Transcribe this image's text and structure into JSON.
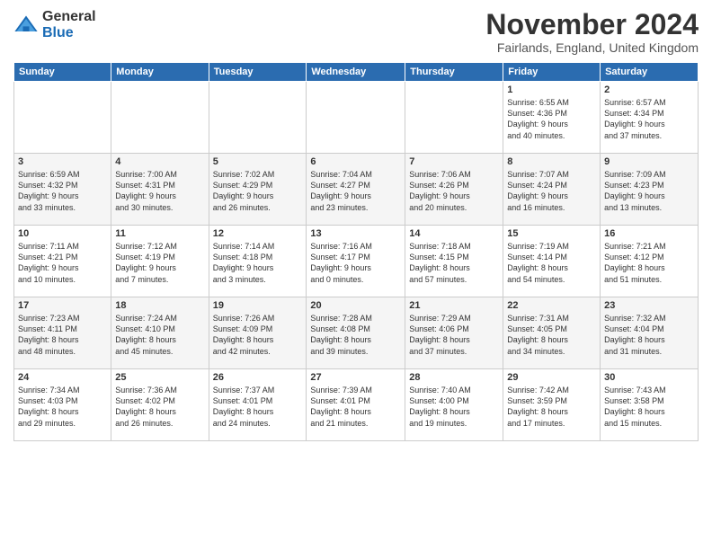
{
  "logo": {
    "general": "General",
    "blue": "Blue"
  },
  "title": "November 2024",
  "subtitle": "Fairlands, England, United Kingdom",
  "days_header": [
    "Sunday",
    "Monday",
    "Tuesday",
    "Wednesday",
    "Thursday",
    "Friday",
    "Saturday"
  ],
  "weeks": [
    [
      {
        "day": "",
        "info": ""
      },
      {
        "day": "",
        "info": ""
      },
      {
        "day": "",
        "info": ""
      },
      {
        "day": "",
        "info": ""
      },
      {
        "day": "",
        "info": ""
      },
      {
        "day": "1",
        "info": "Sunrise: 6:55 AM\nSunset: 4:36 PM\nDaylight: 9 hours\nand 40 minutes."
      },
      {
        "day": "2",
        "info": "Sunrise: 6:57 AM\nSunset: 4:34 PM\nDaylight: 9 hours\nand 37 minutes."
      }
    ],
    [
      {
        "day": "3",
        "info": "Sunrise: 6:59 AM\nSunset: 4:32 PM\nDaylight: 9 hours\nand 33 minutes."
      },
      {
        "day": "4",
        "info": "Sunrise: 7:00 AM\nSunset: 4:31 PM\nDaylight: 9 hours\nand 30 minutes."
      },
      {
        "day": "5",
        "info": "Sunrise: 7:02 AM\nSunset: 4:29 PM\nDaylight: 9 hours\nand 26 minutes."
      },
      {
        "day": "6",
        "info": "Sunrise: 7:04 AM\nSunset: 4:27 PM\nDaylight: 9 hours\nand 23 minutes."
      },
      {
        "day": "7",
        "info": "Sunrise: 7:06 AM\nSunset: 4:26 PM\nDaylight: 9 hours\nand 20 minutes."
      },
      {
        "day": "8",
        "info": "Sunrise: 7:07 AM\nSunset: 4:24 PM\nDaylight: 9 hours\nand 16 minutes."
      },
      {
        "day": "9",
        "info": "Sunrise: 7:09 AM\nSunset: 4:23 PM\nDaylight: 9 hours\nand 13 minutes."
      }
    ],
    [
      {
        "day": "10",
        "info": "Sunrise: 7:11 AM\nSunset: 4:21 PM\nDaylight: 9 hours\nand 10 minutes."
      },
      {
        "day": "11",
        "info": "Sunrise: 7:12 AM\nSunset: 4:19 PM\nDaylight: 9 hours\nand 7 minutes."
      },
      {
        "day": "12",
        "info": "Sunrise: 7:14 AM\nSunset: 4:18 PM\nDaylight: 9 hours\nand 3 minutes."
      },
      {
        "day": "13",
        "info": "Sunrise: 7:16 AM\nSunset: 4:17 PM\nDaylight: 9 hours\nand 0 minutes."
      },
      {
        "day": "14",
        "info": "Sunrise: 7:18 AM\nSunset: 4:15 PM\nDaylight: 8 hours\nand 57 minutes."
      },
      {
        "day": "15",
        "info": "Sunrise: 7:19 AM\nSunset: 4:14 PM\nDaylight: 8 hours\nand 54 minutes."
      },
      {
        "day": "16",
        "info": "Sunrise: 7:21 AM\nSunset: 4:12 PM\nDaylight: 8 hours\nand 51 minutes."
      }
    ],
    [
      {
        "day": "17",
        "info": "Sunrise: 7:23 AM\nSunset: 4:11 PM\nDaylight: 8 hours\nand 48 minutes."
      },
      {
        "day": "18",
        "info": "Sunrise: 7:24 AM\nSunset: 4:10 PM\nDaylight: 8 hours\nand 45 minutes."
      },
      {
        "day": "19",
        "info": "Sunrise: 7:26 AM\nSunset: 4:09 PM\nDaylight: 8 hours\nand 42 minutes."
      },
      {
        "day": "20",
        "info": "Sunrise: 7:28 AM\nSunset: 4:08 PM\nDaylight: 8 hours\nand 39 minutes."
      },
      {
        "day": "21",
        "info": "Sunrise: 7:29 AM\nSunset: 4:06 PM\nDaylight: 8 hours\nand 37 minutes."
      },
      {
        "day": "22",
        "info": "Sunrise: 7:31 AM\nSunset: 4:05 PM\nDaylight: 8 hours\nand 34 minutes."
      },
      {
        "day": "23",
        "info": "Sunrise: 7:32 AM\nSunset: 4:04 PM\nDaylight: 8 hours\nand 31 minutes."
      }
    ],
    [
      {
        "day": "24",
        "info": "Sunrise: 7:34 AM\nSunset: 4:03 PM\nDaylight: 8 hours\nand 29 minutes."
      },
      {
        "day": "25",
        "info": "Sunrise: 7:36 AM\nSunset: 4:02 PM\nDaylight: 8 hours\nand 26 minutes."
      },
      {
        "day": "26",
        "info": "Sunrise: 7:37 AM\nSunset: 4:01 PM\nDaylight: 8 hours\nand 24 minutes."
      },
      {
        "day": "27",
        "info": "Sunrise: 7:39 AM\nSunset: 4:01 PM\nDaylight: 8 hours\nand 21 minutes."
      },
      {
        "day": "28",
        "info": "Sunrise: 7:40 AM\nSunset: 4:00 PM\nDaylight: 8 hours\nand 19 minutes."
      },
      {
        "day": "29",
        "info": "Sunrise: 7:42 AM\nSunset: 3:59 PM\nDaylight: 8 hours\nand 17 minutes."
      },
      {
        "day": "30",
        "info": "Sunrise: 7:43 AM\nSunset: 3:58 PM\nDaylight: 8 hours\nand 15 minutes."
      }
    ]
  ]
}
